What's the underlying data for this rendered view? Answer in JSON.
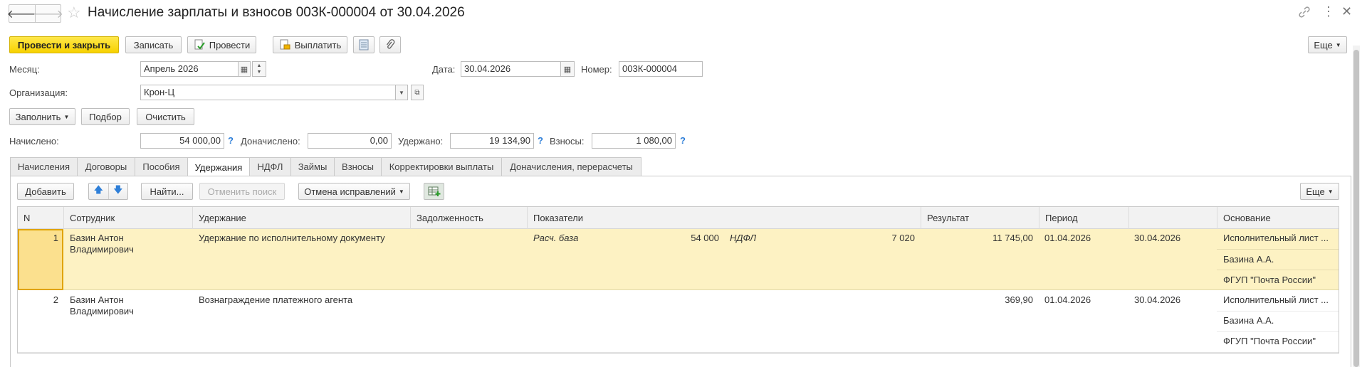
{
  "title": "Начисление зарплаты и взносов 003К-000004 от 30.04.2026",
  "toolbar": {
    "post_close": "Провести и закрыть",
    "save": "Записать",
    "post": "Провести",
    "pay": "Выплатить",
    "more": "Еще"
  },
  "form": {
    "month_label": "Месяц:",
    "month_value": "Апрель 2026",
    "date_label": "Дата:",
    "date_value": "30.04.2026",
    "number_label": "Номер:",
    "number_value": "003К-000004",
    "org_label": "Организация:",
    "org_value": "Крон-Ц"
  },
  "actions": {
    "fill": "Заполнить",
    "select": "Подбор",
    "clear": "Очистить"
  },
  "totals": {
    "accrued_label": "Начислено:",
    "accrued_value": "54 000,00",
    "additional_label": "Доначислено:",
    "additional_value": "0,00",
    "withheld_label": "Удержано:",
    "withheld_value": "19 134,90",
    "contrib_label": "Взносы:",
    "contrib_value": "1 080,00",
    "help": "?"
  },
  "tabs": [
    "Начисления",
    "Договоры",
    "Пособия",
    "Удержания",
    "НДФЛ",
    "Займы",
    "Взносы",
    "Корректировки выплаты",
    "Доначисления, перерасчеты"
  ],
  "active_tab": "Удержания",
  "table_toolbar": {
    "add": "Добавить",
    "find": "Найти...",
    "cancel_search": "Отменить поиск",
    "cancel_fixes": "Отмена исправлений",
    "more": "Еще"
  },
  "table": {
    "headers": {
      "n": "N",
      "employee": "Сотрудник",
      "deduction": "Удержание",
      "debt": "Задолженность",
      "indicators": "Показатели",
      "result": "Результат",
      "period": "Период",
      "basis": "Основание"
    },
    "rows": [
      {
        "n": "1",
        "employee": "Базин Антон Владимирович",
        "deduction": "Удержание по исполнительному документу",
        "ind1_name": "Расч. база",
        "ind1_value": "54 000",
        "ind2_name": "НДФЛ",
        "ind2_value": "7 020",
        "result": "11 745,00",
        "period_start": "01.04.2026",
        "period_end": "30.04.2026",
        "basis1": "Исполнительный лист ...",
        "basis2": "Базина А.А.",
        "basis3": "ФГУП \"Почта России\""
      },
      {
        "n": "2",
        "employee": "Базин Антон Владимирович",
        "deduction": "Вознаграждение платежного агента",
        "ind1_name": "",
        "ind1_value": "",
        "ind2_name": "",
        "ind2_value": "",
        "result": "369,90",
        "period_start": "01.04.2026",
        "period_end": "30.04.2026",
        "basis1": "Исполнительный лист ...",
        "basis2": "Базина А.А.",
        "basis3": "ФГУП \"Почта России\""
      }
    ]
  },
  "colors": {
    "primary_button": "#f7d200",
    "selected_row": "#fdf2c3",
    "selected_cell": "#fbe08e",
    "help_link": "#2e7fd8"
  }
}
